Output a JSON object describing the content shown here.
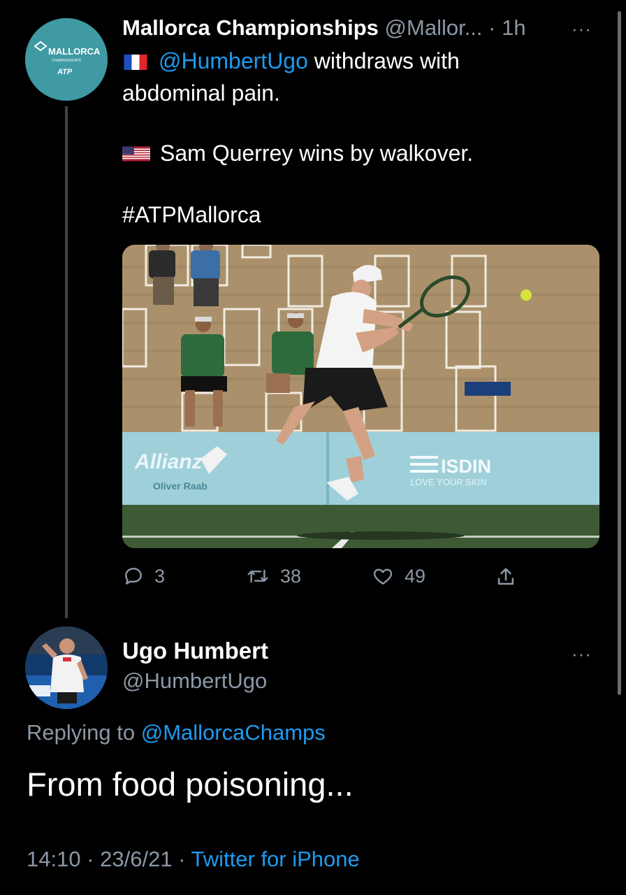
{
  "tweet": {
    "account_name": "Mallorca Championships",
    "handle": "@Mallor...",
    "time": "· 1h",
    "logo_text": "MALLORCA",
    "logo_sub": "CHAMPIONSHIPS",
    "logo_atp": "ATP",
    "mention": "@HumbertUgo",
    "line1_rest": " withdraws with",
    "line2": "abdominal pain.",
    "line3": "Sam Querrey wins by walkover.",
    "hashtag": "#ATPMallorca",
    "image": {
      "board_left_brand": "Allianz",
      "board_left_sub": "Oliver Raab",
      "board_right_brand": "ISDIN",
      "board_right_sub": "LOVE YOUR SKIN"
    },
    "reply_count": "3",
    "retweet_count": "38",
    "like_count": "49"
  },
  "reply": {
    "name": "Ugo Humbert",
    "handle": "@HumbertUgo",
    "replying_prefix": "Replying to ",
    "replying_to": "@MallorcaChamps",
    "text": "From food poisoning...",
    "timestamp": "14:10 · 23/6/21 · ",
    "source": "Twitter for iPhone"
  },
  "more_icon": "···",
  "colors": {
    "link": "#1d9bf0",
    "muted": "#8b98a5",
    "background": "#000000"
  }
}
